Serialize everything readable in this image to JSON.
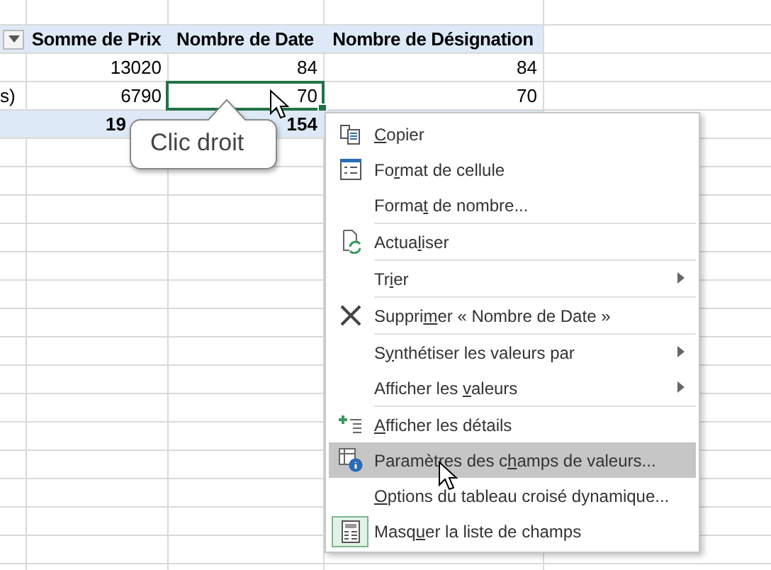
{
  "pivot": {
    "headers": [
      "Somme de Prix",
      "Nombre de Date",
      "Nombre de Désignation"
    ],
    "rows": [
      {
        "kind": "data",
        "cells": [
          {
            "text": "13020",
            "selected": false
          },
          {
            "text": "84",
            "selected": false
          },
          {
            "text": "84",
            "selected": false
          }
        ]
      },
      {
        "kind": "data",
        "label": "s)",
        "cells": [
          {
            "text": "6790",
            "selected": false
          },
          {
            "text": "70",
            "selected": true
          },
          {
            "text": "70",
            "selected": false
          }
        ]
      },
      {
        "kind": "total",
        "cells": [
          {
            "text": "19",
            "selected": false
          },
          {
            "text": "154",
            "selected": false
          }
        ]
      }
    ]
  },
  "callout": {
    "text": "Clic droit"
  },
  "context_menu": {
    "items": [
      {
        "kind": "item",
        "key": "C",
        "post": "opier",
        "submenu": false,
        "selected": false,
        "checked": false
      },
      {
        "kind": "item",
        "pre": "Fo",
        "key": "r",
        "post": "mat de cellule",
        "submenu": false,
        "selected": false,
        "checked": false
      },
      {
        "kind": "item",
        "pre": "Forma",
        "key": "t",
        "post": " de nombre...",
        "submenu": false,
        "selected": false,
        "checked": false
      },
      {
        "kind": "separator"
      },
      {
        "kind": "item",
        "pre": "Actua",
        "key": "l",
        "post": "iser",
        "submenu": false,
        "selected": false,
        "checked": false
      },
      {
        "kind": "separator"
      },
      {
        "kind": "item",
        "pre": "Tr",
        "key": "i",
        "post": "er",
        "submenu": true,
        "selected": false,
        "checked": false
      },
      {
        "kind": "separator"
      },
      {
        "kind": "item",
        "pre": "Suppri",
        "key": "m",
        "post": "er « Nombre de Date »",
        "submenu": false,
        "selected": false,
        "checked": false
      },
      {
        "kind": "separator"
      },
      {
        "kind": "item",
        "pre": "S",
        "key": "y",
        "post": "nthétiser les valeurs par",
        "submenu": true,
        "selected": false,
        "checked": false
      },
      {
        "kind": "item",
        "pre": "Afficher les ",
        "key": "v",
        "post": "aleurs",
        "submenu": true,
        "selected": false,
        "checked": false
      },
      {
        "kind": "separator"
      },
      {
        "kind": "item",
        "key": "A",
        "post": "fficher les détails",
        "submenu": false,
        "selected": false,
        "checked": false
      },
      {
        "kind": "item",
        "pre": "Paramètres des c",
        "key": "h",
        "post": "amps de valeurs...",
        "submenu": false,
        "selected": true,
        "checked": false
      },
      {
        "kind": "item",
        "key": "O",
        "post": "ptions du tableau croisé dynamique...",
        "submenu": false,
        "selected": false,
        "checked": false
      },
      {
        "kind": "item",
        "pre": "Masq",
        "key": "u",
        "post": "er la liste de champs",
        "submenu": false,
        "selected": false,
        "checked": true
      }
    ]
  }
}
